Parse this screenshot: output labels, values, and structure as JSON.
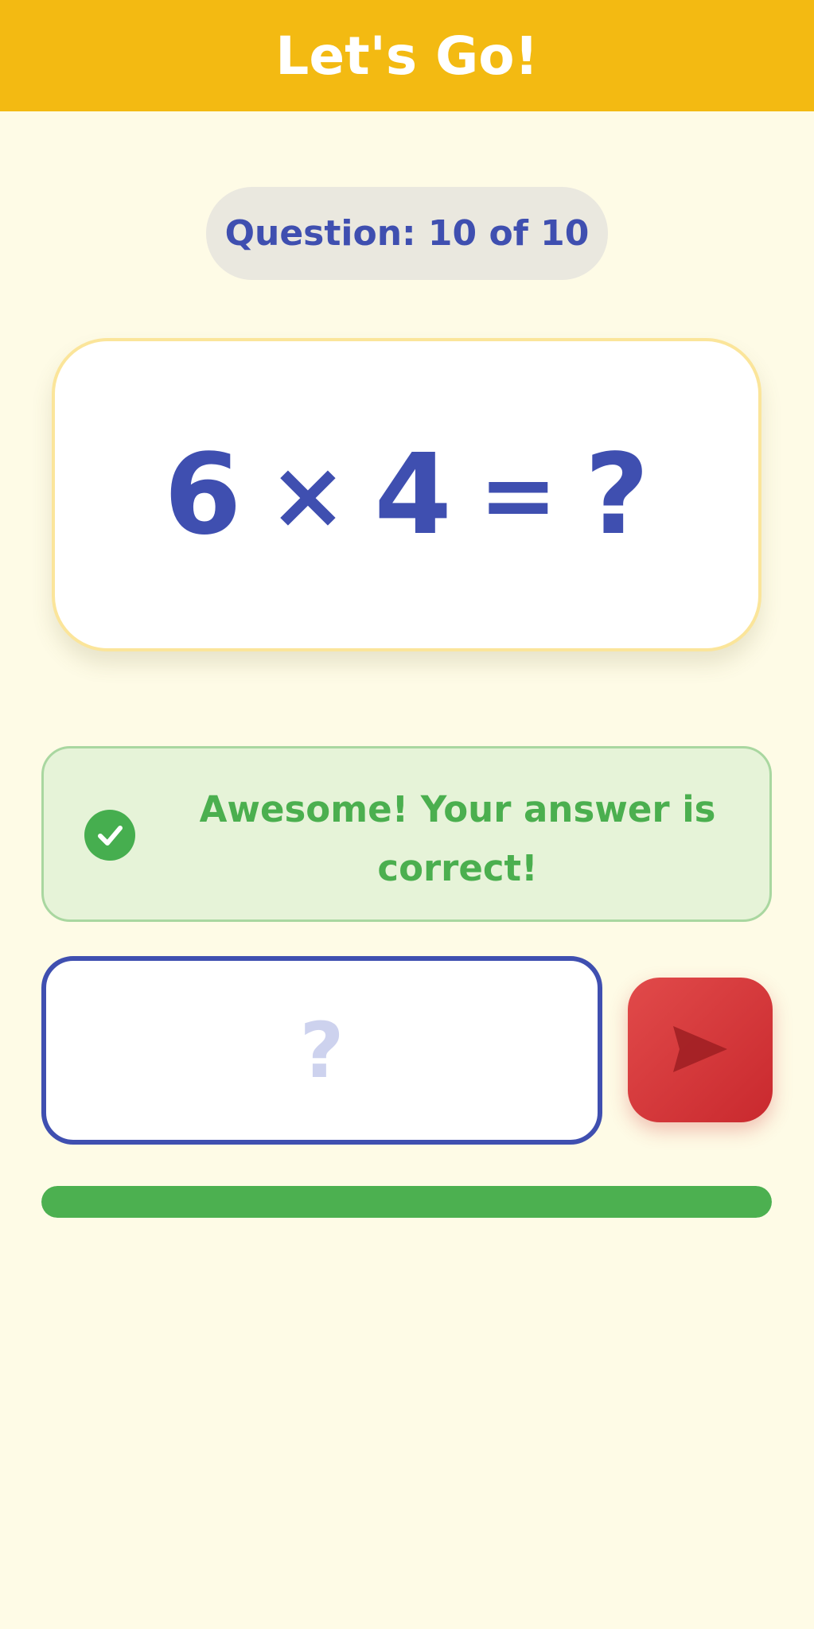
{
  "app_bar": {
    "title": "Let's Go!"
  },
  "question_counter": {
    "label": "Question: 10 of 10"
  },
  "equation": {
    "left_operand": "6",
    "operator": "×",
    "right_operand": "4",
    "equals": "=",
    "unknown": "?"
  },
  "feedback": {
    "message": "Awesome! Your answer is correct!",
    "icon": "check-circle-icon"
  },
  "answer": {
    "value": "",
    "placeholder": "?"
  },
  "submit": {
    "icon": "send-icon"
  },
  "progress": {
    "fraction": 1.0
  },
  "colors": {
    "app_bar": "#F3BA12",
    "background": "#FEFBE6",
    "primary_blue": "#3F4FB0",
    "success_green": "#4CB050",
    "submit_red": "#D63A3A"
  }
}
